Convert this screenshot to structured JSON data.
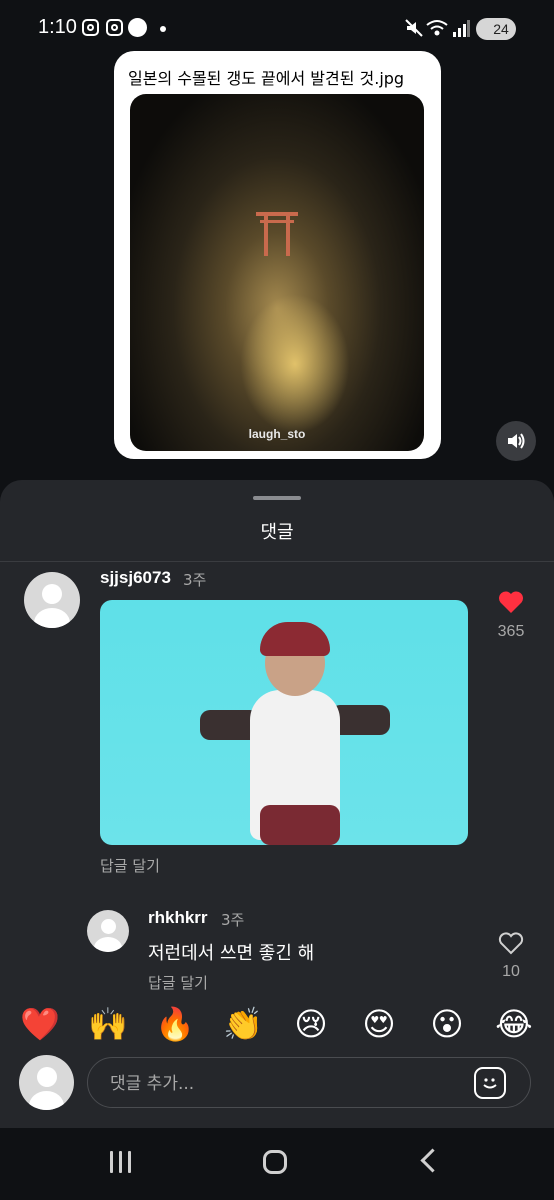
{
  "status_bar": {
    "time": "1:10",
    "battery": "24",
    "icons": [
      "instagram-icon",
      "instagram-icon",
      "chat-bubble-icon",
      "dot-icon",
      "mute-icon",
      "wifi-icon",
      "signal-icon",
      "battery-icon"
    ]
  },
  "post": {
    "title": "일본의 수몰된 갱도 끝에서 발견된 것.jpg",
    "watermark": "laugh_sto"
  },
  "comments_sheet": {
    "title": "댓글",
    "comments": [
      {
        "username": "sjjsj6073",
        "time": "3주",
        "media": "gif",
        "reply_label": "답글 달기",
        "likes": "365",
        "liked": true
      },
      {
        "username": "rhkhkrr",
        "time": "3주",
        "text": "저런데서 쓰면 좋긴 해",
        "reply_label": "답글 달기",
        "likes": "10",
        "liked": false
      }
    ]
  },
  "emoji_bar": [
    "❤️",
    "🙌",
    "🔥",
    "👏",
    "😢",
    "😍",
    "😮",
    "😂"
  ],
  "input": {
    "placeholder": "댓글 추가..."
  },
  "colors": {
    "sheet_bg": "#25272b",
    "like_red": "#ff3040",
    "muted_text": "#a8a8a8"
  }
}
